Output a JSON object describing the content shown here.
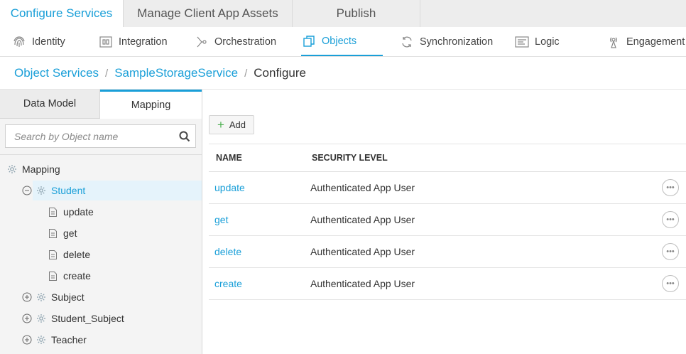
{
  "top_tabs": [
    {
      "label": "Configure Services",
      "active": true
    },
    {
      "label": "Manage Client App Assets",
      "active": false
    },
    {
      "label": "Publish",
      "active": false
    }
  ],
  "subnav": [
    {
      "label": "Identity",
      "icon": "fingerprint-icon"
    },
    {
      "label": "Integration",
      "icon": "integration-icon"
    },
    {
      "label": "Orchestration",
      "icon": "orchestration-icon"
    },
    {
      "label": "Objects",
      "icon": "objects-icon",
      "active": true
    },
    {
      "label": "Synchronization",
      "icon": "sync-icon"
    },
    {
      "label": "Logic",
      "icon": "logic-icon"
    },
    {
      "label": "Engagement",
      "icon": "engagement-icon"
    }
  ],
  "breadcrumb": {
    "items": [
      "Object Services",
      "SampleStorageService"
    ],
    "separator": "/",
    "current": "Configure"
  },
  "left_panel": {
    "tabs": [
      "Data Model",
      "Mapping"
    ],
    "active_tab": "Mapping",
    "search_placeholder": "Search by Object name",
    "tree": {
      "root": "Mapping",
      "expanded": {
        "label": "Student",
        "children": [
          "update",
          "get",
          "delete",
          "create"
        ]
      },
      "collapsed": [
        "Subject",
        "Student_Subject",
        "Teacher"
      ]
    }
  },
  "toolbar": {
    "add_label": "Add"
  },
  "table": {
    "headers": [
      "NAME",
      "SECURITY LEVEL"
    ],
    "rows": [
      {
        "name": "update",
        "security": "Authenticated App User"
      },
      {
        "name": "get",
        "security": "Authenticated App User"
      },
      {
        "name": "delete",
        "security": "Authenticated App User"
      },
      {
        "name": "create",
        "security": "Authenticated App User"
      }
    ],
    "row_action_label": "•••"
  },
  "colors": {
    "accent": "#1a9fd8",
    "add_plus": "#4caf50",
    "selected_row_bg": "#e5f3fb"
  }
}
